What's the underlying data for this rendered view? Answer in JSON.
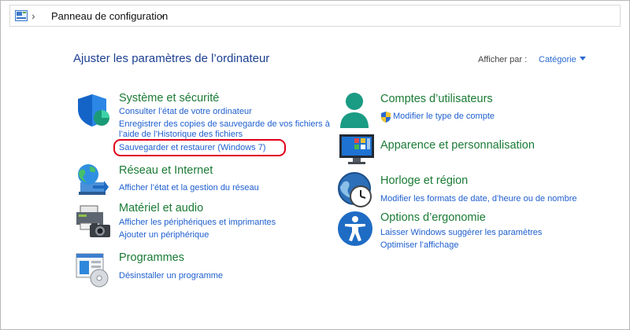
{
  "address": {
    "breadcrumb": "Panneau de configuration",
    "icon": "control-panel-icon"
  },
  "header": {
    "title": "Ajuster les paramètres de l’ordinateur",
    "view_by_label": "Afficher par :",
    "view_by_value": "Catégorie"
  },
  "categories": {
    "system": {
      "title": "Système et sécurité",
      "links": [
        "Consulter l’état de votre ordinateur",
        "Enregistrer des copies de sauvegarde de vos fichiers à",
        "l’aide de l’Historique des fichiers",
        "Sauvegarder et restaurer (Windows 7)"
      ],
      "icon": "shield-icon"
    },
    "network": {
      "title": "Réseau et Internet",
      "links": [
        "Afficher l’état et la gestion du réseau"
      ],
      "icon": "globe-network-icon"
    },
    "hardware": {
      "title": "Matériel et audio",
      "links": [
        "Afficher les périphériques et imprimantes",
        "Ajouter un périphérique"
      ],
      "icon": "printer-camera-icon"
    },
    "programs": {
      "title": "Programmes",
      "links": [
        "Désinstaller un programme"
      ],
      "icon": "programs-disc-icon"
    },
    "accounts": {
      "title": "Comptes d’utilisateurs",
      "links": [
        "Modifier le type de compte"
      ],
      "icon": "user-icon"
    },
    "appearance": {
      "title": "Apparence et personnalisation",
      "links": [],
      "icon": "monitor-icon"
    },
    "clock": {
      "title": "Horloge et région",
      "links": [
        "Modifier les formats de date, d’heure ou de nombre"
      ],
      "icon": "clock-globe-icon"
    },
    "ease": {
      "title": "Options d’ergonomie",
      "links": [
        "Laisser Windows suggérer les paramètres",
        "Optimiser l’affichage"
      ],
      "icon": "accessibility-icon"
    }
  },
  "colors": {
    "category_title": "#1a7b35",
    "link": "#1f5fcf",
    "heading": "#1c3f91",
    "highlight": "#e2001a"
  }
}
